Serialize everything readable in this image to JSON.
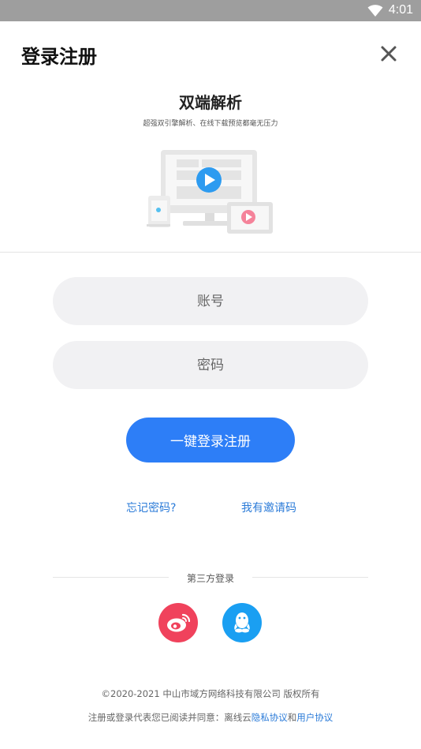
{
  "status_bar": {
    "time": "4:01"
  },
  "header": {
    "title": "登录注册"
  },
  "banner": {
    "title": "双端解析",
    "subtitle": "超强双引擎解析、在线下载预览都毫无压力"
  },
  "form": {
    "account_placeholder": "账号",
    "password_placeholder": "密码",
    "login_button": "一键登录注册"
  },
  "links": {
    "forgot_password": "忘记密码?",
    "invite_code": "我有邀请码"
  },
  "third_party": {
    "label": "第三方登录"
  },
  "footer": {
    "copyright": "©2020-2021 中山市域方网络科技有限公司 版权所有",
    "agreement_prefix": "注册或登录代表您已阅读并同意：离线云",
    "privacy_link": "隐私协议",
    "conjunction": "和",
    "user_link": "用户协议"
  },
  "colors": {
    "primary": "#2d7ef7",
    "link": "#2b7bd8",
    "weibo": "#f0425c",
    "qq": "#1a9ff2"
  }
}
